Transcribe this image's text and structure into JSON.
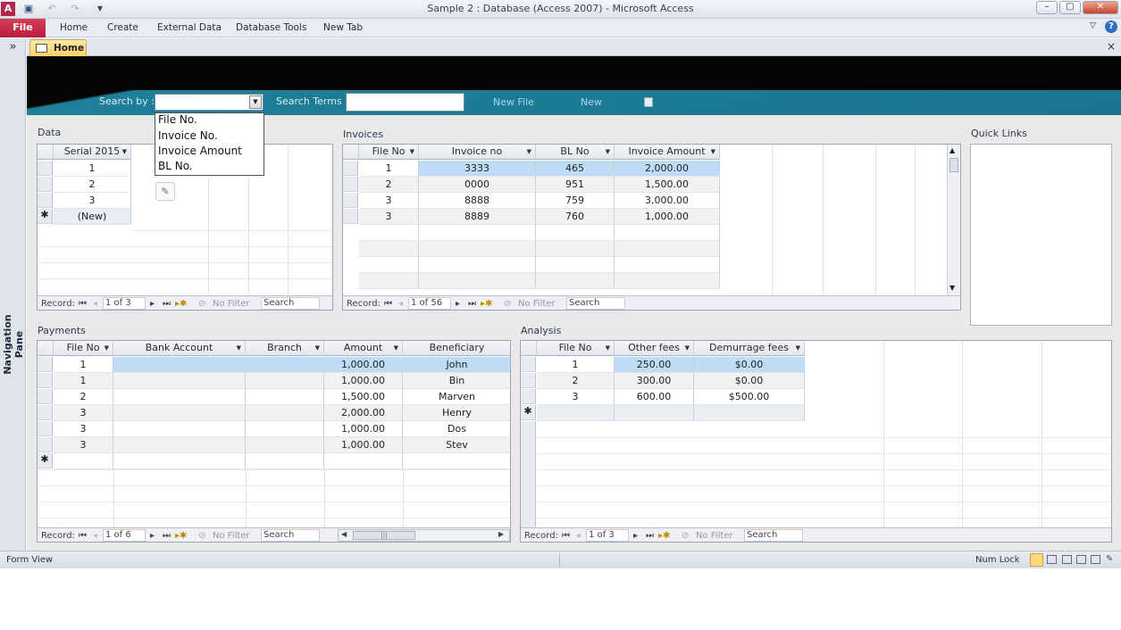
{
  "window": {
    "title": "Sample 2 : Database (Access 2007)  -  Microsoft Access",
    "controls": [
      "–",
      "▢",
      "✕"
    ]
  },
  "ribbon": {
    "file": "File",
    "tabs": [
      "Home",
      "Create",
      "External Data",
      "Database Tools",
      "New Tab"
    ]
  },
  "nav_pane": {
    "toggle": "»",
    "label": "Navigation Pane"
  },
  "doc_tab": {
    "label": "Home",
    "close": "×"
  },
  "search": {
    "search_by_label": "Search by :",
    "search_terms_label": "Search Terms",
    "new_file": "New File",
    "new": "New",
    "dropdown_options": [
      "File No.",
      "Invoice No.",
      "Invoice Amount",
      "BL No."
    ]
  },
  "sections": {
    "data": "Data",
    "invoices": "Invoices",
    "quick_links": "Quick Links",
    "payments": "Payments",
    "analysis": "Analysis"
  },
  "data_table": {
    "columns": [
      "Serial 2015"
    ],
    "rows": [
      [
        "1"
      ],
      [
        "2"
      ],
      [
        "3"
      ]
    ],
    "new_row": "(New)",
    "record": "1 of 3"
  },
  "invoices_table": {
    "columns": [
      "File No",
      "Invoice no",
      "BL No",
      "Invoice Amount"
    ],
    "rows": [
      [
        "1",
        "3333",
        "465",
        "2,000.00"
      ],
      [
        "2",
        "0000",
        "951",
        "1,500.00"
      ],
      [
        "3",
        "8888",
        "759",
        "3,000.00"
      ],
      [
        "3",
        "8889",
        "760",
        "1,000.00"
      ]
    ],
    "record": "1 of 56"
  },
  "payments_table": {
    "columns": [
      "File No",
      "Bank Account",
      "Branch",
      "Amount",
      "Beneficiary"
    ],
    "rows": [
      [
        "1",
        "",
        "",
        "1,000.00",
        "John"
      ],
      [
        "1",
        "",
        "",
        "1,000.00",
        "Bin"
      ],
      [
        "2",
        "",
        "",
        "1,500.00",
        "Marven"
      ],
      [
        "3",
        "",
        "",
        "2,000.00",
        "Henry"
      ],
      [
        "3",
        "",
        "",
        "1,000.00",
        "Dos"
      ],
      [
        "3",
        "",
        "",
        "1,000.00",
        "Stev"
      ]
    ],
    "record": "1 of 6"
  },
  "analysis_table": {
    "columns": [
      "File No",
      "Other fees",
      "Demurrage fees"
    ],
    "rows": [
      [
        "1",
        "250.00",
        "$0.00"
      ],
      [
        "2",
        "300.00",
        "$0.00"
      ],
      [
        "3",
        "600.00",
        "$500.00"
      ]
    ],
    "record": "1 of 3"
  },
  "record_nav": {
    "record_label": "Record:",
    "no_filter": "No Filter",
    "search": "Search"
  },
  "status": {
    "view": "Form View",
    "num_lock": "Num Lock"
  }
}
